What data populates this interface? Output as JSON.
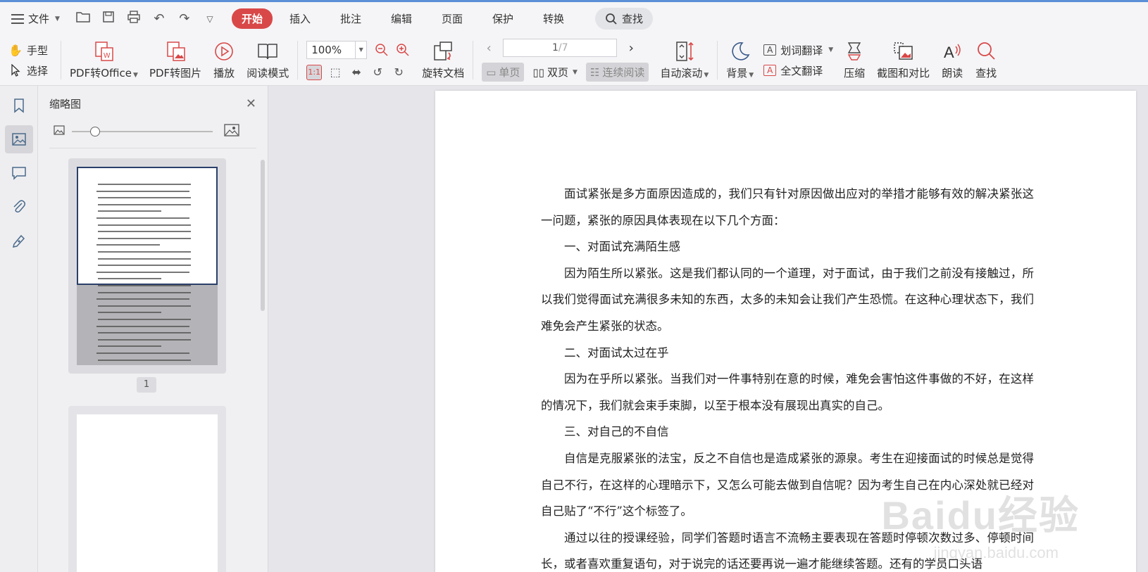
{
  "menubar": {
    "file_label": "文件",
    "tabs": [
      "开始",
      "插入",
      "批注",
      "编辑",
      "页面",
      "保护",
      "转换"
    ],
    "active_tab": "开始",
    "search_label": "查找"
  },
  "ribbon": {
    "hand_tool": "手型",
    "select_tool": "选择",
    "pdf_to_office": "PDF转Office",
    "pdf_to_image": "PDF转图片",
    "play": "播放",
    "reading_mode": "阅读模式",
    "zoom_value": "100%",
    "rotate_doc": "旋转文档",
    "page_current": "1",
    "page_total": "/7",
    "single_page": "单页",
    "double_page": "双页",
    "continuous": "连续阅读",
    "auto_scroll": "自动滚动",
    "background": "背景",
    "word_translate": "划词翻译",
    "full_translate": "全文翻译",
    "compress": "压缩",
    "screenshot_compare": "截图和对比",
    "read_aloud": "朗读",
    "find": "查找",
    "accent_color": "#d94848"
  },
  "thumbnail_panel": {
    "title": "缩略图",
    "page_label": "1"
  },
  "document": {
    "paragraphs": [
      "面试紧张是多方面原因造成的，我们只有针对原因做出应对的举措才能够有效的解决紧张这一问题，紧张的原因具体表现在以下几个方面：",
      "一、对面试充满陌生感",
      "因为陌生所以紧张。这是我们都认同的一个道理，对于面试，由于我们之前没有接触过，所以我们觉得面试充满很多未知的东西，太多的未知会让我们产生恐慌。在这种心理状态下，我们难免会产生紧张的状态。",
      "二、对面试太过在乎",
      "因为在乎所以紧张。当我们对一件事特别在意的时候，难免会害怕这件事做的不好，在这样的情况下，我们就会束手束脚，以至于根本没有展现出真实的自己。",
      "三、对自己的不自信",
      "自信是克服紧张的法宝，反之不自信也是造成紧张的源泉。考生在迎接面试的时候总是觉得自己不行，在这样的心理暗示下，又怎么可能去做到自信呢？因为考生自己在内心深处就已经对自己贴了“不行”这个标签了。",
      "通过以往的授课经验，同学们答题时语言不流畅主要表现在答题时停顿次数过多、停顿时间长，或者喜欢重复语句，对于说完的话还要再说一遍才能继续答题。还有的学员口头语"
    ]
  },
  "watermark": {
    "main": "Baidu经验",
    "sub": "jingyan.baidu.com"
  }
}
